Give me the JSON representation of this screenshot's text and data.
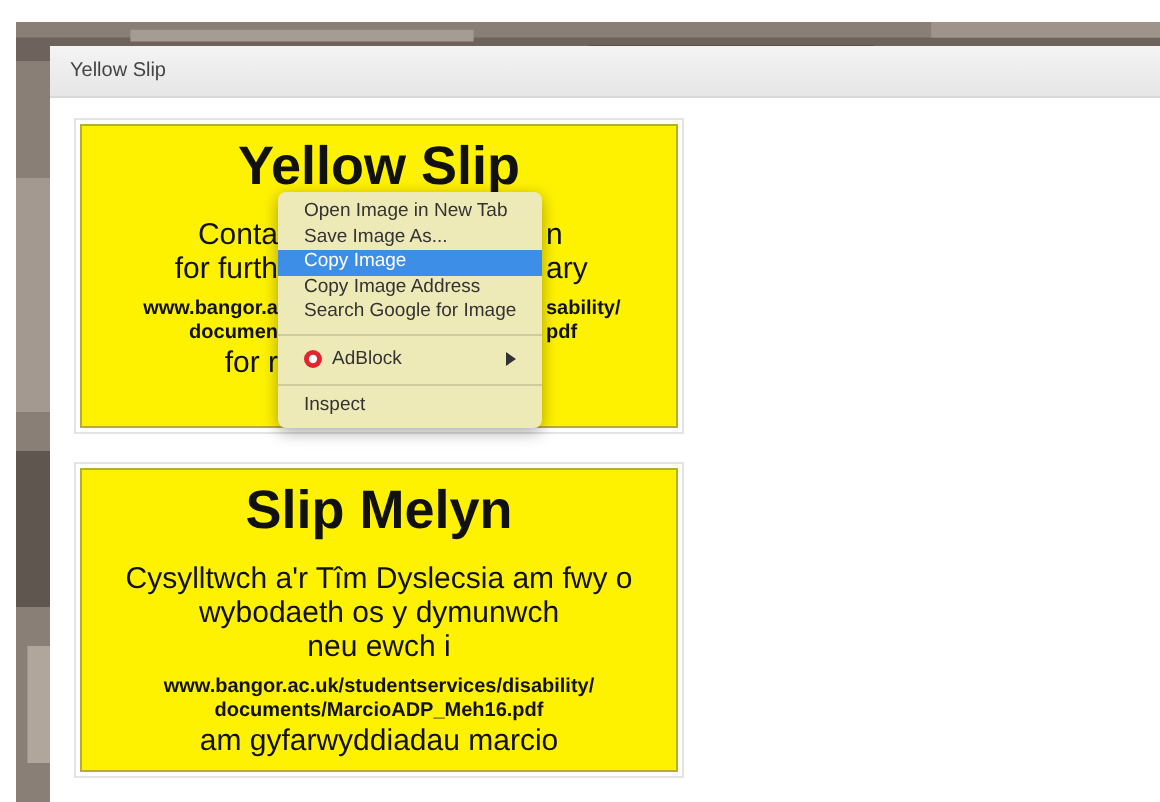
{
  "window": {
    "title": "Yellow Slip"
  },
  "slips": [
    {
      "kind": "covered",
      "title": "Yellow Slip",
      "lines": [
        {
          "kind": "body",
          "left": "Conta",
          "right": "n"
        },
        {
          "kind": "body",
          "left": "for furth",
          "right": "ary"
        },
        {
          "kind": "url",
          "left": "www.bangor.a",
          "right": "sability/"
        },
        {
          "kind": "url",
          "left": "documen",
          "right": "pdf"
        },
        {
          "kind": "body",
          "left": "for r"
        }
      ]
    },
    {
      "kind": "full",
      "title": "Slip Melyn",
      "lines": [
        {
          "kind": "body",
          "text": "Cysylltwch a'r Tîm Dyslecsia am fwy o"
        },
        {
          "kind": "body",
          "text": "wybodaeth os y dymunwch"
        },
        {
          "kind": "body",
          "text": "neu ewch i"
        },
        {
          "kind": "url",
          "text": "www.bangor.ac.uk/studentservices/disability/"
        },
        {
          "kind": "url",
          "text": "documents/MarcioADP_Meh16.pdf"
        },
        {
          "kind": "body",
          "text": "am gyfarwyddiadau marcio"
        }
      ]
    }
  ],
  "context_menu": {
    "groups": [
      [
        {
          "label": "Open Image in New Tab",
          "selected": false,
          "kind": "plain"
        },
        {
          "label": "Save Image As...",
          "selected": false,
          "kind": "plain"
        },
        {
          "label": "Copy Image",
          "selected": true,
          "kind": "plain"
        },
        {
          "label": "Copy Image Address",
          "selected": false,
          "kind": "plain"
        },
        {
          "label": "Search Google for Image",
          "selected": false,
          "kind": "plain"
        }
      ],
      [
        {
          "label": "AdBlock",
          "selected": false,
          "kind": "extension"
        }
      ],
      [
        {
          "label": "Inspect",
          "selected": false,
          "kind": "plain"
        }
      ]
    ]
  }
}
